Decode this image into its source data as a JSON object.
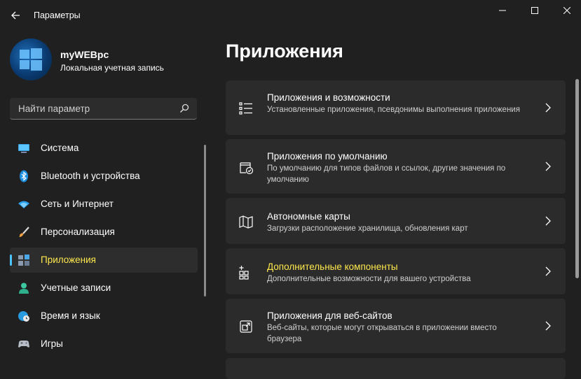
{
  "window": {
    "title": "Параметры"
  },
  "profile": {
    "name": "myWEBpc",
    "account_type": "Локальная учетная запись"
  },
  "search": {
    "placeholder": "Найти параметр"
  },
  "sidebar": {
    "items": [
      {
        "label": "Система",
        "icon": "monitor-icon"
      },
      {
        "label": "Bluetooth и устройства",
        "icon": "bluetooth-icon"
      },
      {
        "label": "Сеть и Интернет",
        "icon": "wifi-icon"
      },
      {
        "label": "Персонализация",
        "icon": "brush-icon"
      },
      {
        "label": "Приложения",
        "icon": "apps-icon",
        "active": true
      },
      {
        "label": "Учетные записи",
        "icon": "person-icon"
      },
      {
        "label": "Время и язык",
        "icon": "globe-clock-icon"
      },
      {
        "label": "Игры",
        "icon": "gamepad-icon"
      }
    ]
  },
  "main": {
    "title": "Приложения",
    "cards": [
      {
        "title": "Приложения и возможности",
        "subtitle": "Установленные приложения, псевдонимы выполнения приложения",
        "icon": "list-icon"
      },
      {
        "title": "Приложения по умолчанию",
        "subtitle": "По умолчанию для типов файлов и ссылок, другие значения по умолчанию",
        "icon": "default-apps-icon"
      },
      {
        "title": "Автономные карты",
        "subtitle": "Загрузки расположение хранилища, обновления карт",
        "icon": "map-icon"
      },
      {
        "title": "Дополнительные компоненты",
        "subtitle": "Дополнительные возможности для вашего устройства",
        "icon": "add-components-icon",
        "highlighted": true
      },
      {
        "title": "Приложения для веб-сайтов",
        "subtitle": "Веб-сайты, которые могут открываться в приложении вместо браузера",
        "icon": "open-web-icon"
      }
    ]
  },
  "colors": {
    "background": "#202020",
    "card": "#2b2b2b",
    "accent": "#4cc2ff",
    "highlight_text": "#ffe94d"
  }
}
